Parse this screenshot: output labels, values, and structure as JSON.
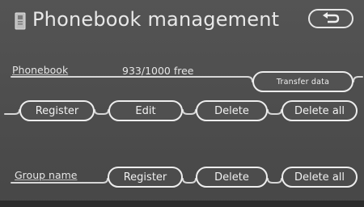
{
  "header": {
    "title": "Phonebook management",
    "back_icon": "return-arrow-icon"
  },
  "phonebook": {
    "label": "Phonebook",
    "count_text": "933/1000 free",
    "transfer_label": "Transfer data",
    "buttons": [
      "Register",
      "Edit",
      "Delete",
      "Delete all"
    ]
  },
  "group": {
    "label": "Group name",
    "buttons": [
      "Register",
      "Delete",
      "Delete all"
    ]
  },
  "colors": {
    "background": "#4f4f4f",
    "text": "#e8e8e8",
    "outline": "#e6e6e6"
  }
}
